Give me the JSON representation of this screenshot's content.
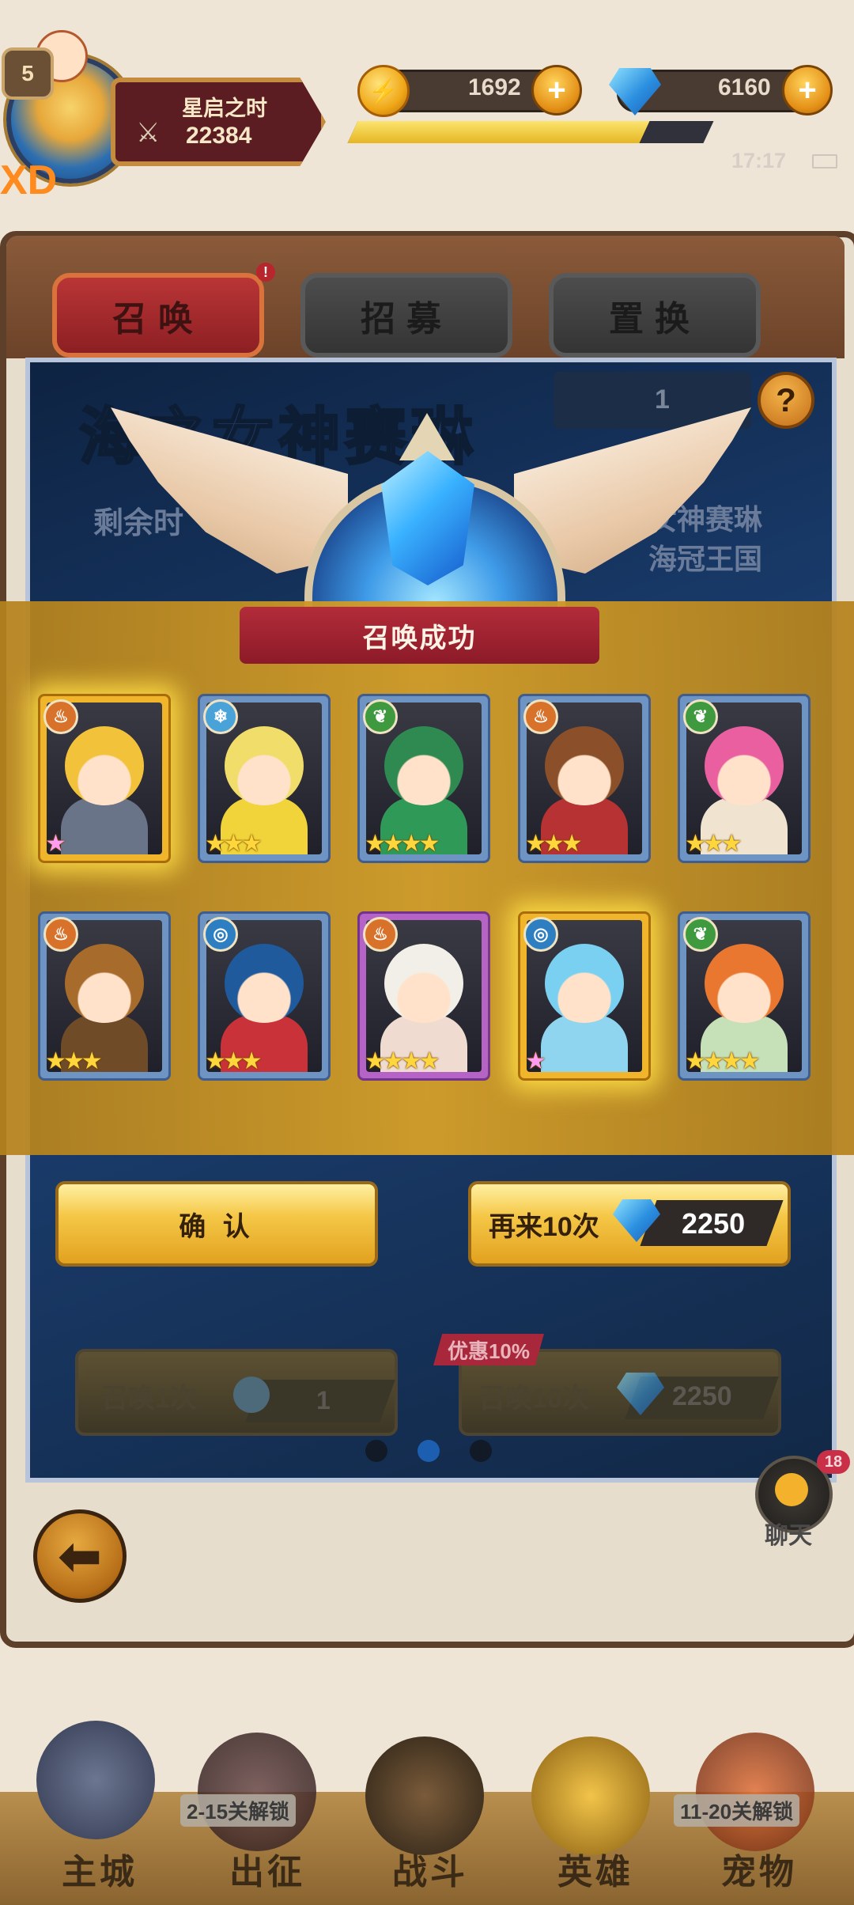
{
  "player": {
    "level": "5",
    "name": "星启之时",
    "power": "22384"
  },
  "resources": {
    "coins": "1692",
    "gems": "6160",
    "exp_fraction": 0.82
  },
  "status": {
    "time": "17:17",
    "corner_text": "XD"
  },
  "tabs": [
    {
      "label": "召唤",
      "active": true
    },
    {
      "label": "招募",
      "active": false
    },
    {
      "label": "置换",
      "active": false
    }
  ],
  "banner": {
    "title": "海之女神赛琳",
    "remaining_label": "剩余时",
    "right_line1": "女神赛琳",
    "right_line2": "海冠王国",
    "ticket_count": "1",
    "help": "?"
  },
  "result": {
    "title": "召唤成功",
    "cards": [
      {
        "element": "fire",
        "stars": "★",
        "star_color": "pink",
        "frame": "gold"
      },
      {
        "element": "ice",
        "stars": "★★★",
        "star_color": "gold",
        "frame": "blue"
      },
      {
        "element": "nature",
        "stars": "★★★★",
        "star_color": "gold",
        "frame": "blue"
      },
      {
        "element": "fire",
        "stars": "★★★",
        "star_color": "gold",
        "frame": "blue"
      },
      {
        "element": "nature",
        "stars": "★★★",
        "star_color": "gold",
        "frame": "blue"
      },
      {
        "element": "fire",
        "stars": "★★★",
        "star_color": "gold",
        "frame": "blue"
      },
      {
        "element": "water",
        "stars": "★★★",
        "star_color": "gold",
        "frame": "blue"
      },
      {
        "element": "fire",
        "stars": "★★★★",
        "star_color": "gold",
        "frame": "purple"
      },
      {
        "element": "water",
        "stars": "★",
        "star_color": "pink",
        "frame": "gold"
      },
      {
        "element": "nature",
        "stars": "★★★★",
        "star_color": "gold",
        "frame": "blue"
      }
    ]
  },
  "actions": {
    "confirm_label": "确 认",
    "again_label": "再来10次",
    "again_cost": "2250"
  },
  "summon": {
    "one_label": "召唤1次",
    "one_cost": "1",
    "ten_label": "召唤10次",
    "ten_cost": "2250",
    "discount": "优惠10%"
  },
  "chat": {
    "label": "聊天",
    "badge": "18"
  },
  "nav": {
    "items": [
      {
        "label": "主城",
        "lock": ""
      },
      {
        "label": "出征",
        "lock": "2-15关解锁"
      },
      {
        "label": "战斗",
        "lock": ""
      },
      {
        "label": "英雄",
        "lock": ""
      },
      {
        "label": "宠物",
        "lock": "11-20关解锁"
      }
    ]
  },
  "colors": {
    "fire": "#d8722a",
    "ice": "#4aa3d8",
    "nature": "#3f9a3f",
    "water": "#2d7fc2",
    "accent_red": "#8c1a28",
    "gold": "#f5c747"
  }
}
